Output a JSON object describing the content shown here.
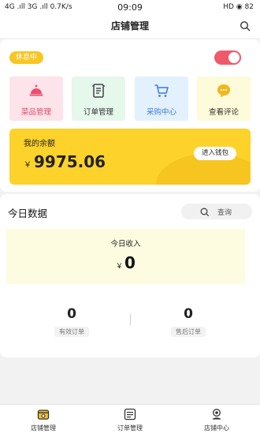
{
  "status_bar": {
    "left": "4G .ıll 3G .ıll 0.7K/s",
    "time": "09:09",
    "right": "HD ◉ 82"
  },
  "header": {
    "title": "店铺管理",
    "search_icon": "search-icon"
  },
  "store": {
    "status_badge": "休息中",
    "open_toggle": {
      "on": true,
      "color": "#ef5a6b"
    }
  },
  "quick_actions": [
    {
      "label": "菜品管理",
      "icon": "cloche-icon",
      "bg": "#fde3ea",
      "color": "#e85070",
      "text_color": "#e04a6a"
    },
    {
      "label": "订单管理",
      "icon": "document-icon",
      "bg": "#e6f7ec",
      "color": "#444444",
      "text_color": "#333333"
    },
    {
      "label": "采购中心",
      "icon": "cart-icon",
      "bg": "#e3f1fd",
      "color": "#3b7ad9",
      "text_color": "#3b7ad9"
    },
    {
      "label": "查看评论",
      "icon": "comment-icon",
      "bg": "#fdfbd9",
      "color": "#f2b51c",
      "text_color": "#333333"
    }
  ],
  "wallet": {
    "label": "我的余额",
    "currency": "￥",
    "amount": "9975.06",
    "button": "进入钱包"
  },
  "today": {
    "title": "今日数据",
    "query_button": "查询",
    "income_label": "今日收入",
    "income_currency": "￥",
    "income_value": "0",
    "stats": [
      {
        "value": "0",
        "label": "有效订单"
      },
      {
        "value": "0",
        "label": "售后订单"
      }
    ]
  },
  "tabbar": [
    {
      "label": "店铺管理",
      "icon": "store-icon",
      "active": true
    },
    {
      "label": "订单管理",
      "icon": "order-list-icon",
      "active": false
    },
    {
      "label": "店铺中心",
      "icon": "user-center-icon",
      "active": false
    }
  ]
}
